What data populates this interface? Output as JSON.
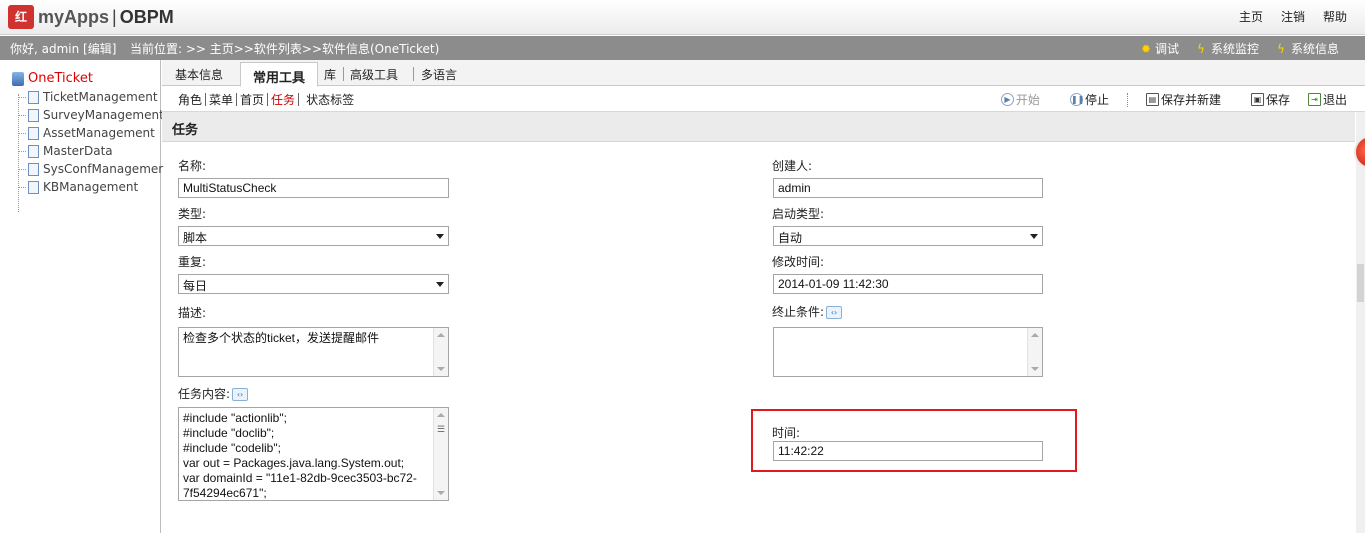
{
  "header": {
    "logo_mark": "红",
    "app_name": "myApps",
    "separator": "|",
    "product": "OBPM",
    "links": [
      "主页",
      "注销",
      "帮助"
    ]
  },
  "infobar": {
    "greeting": "你好, admin [编辑]",
    "breadcrumb": "当前位置: >> 主页>>软件列表>>软件信息(OneTicket)",
    "tools": [
      {
        "label": "调试",
        "icon": "debug-icon"
      },
      {
        "label": "系统监控",
        "icon": "lightning-icon"
      },
      {
        "label": "系统信息",
        "icon": "lightning-icon"
      }
    ]
  },
  "tree": {
    "root": "OneTicket",
    "items": [
      "TicketManagement",
      "SurveyManagement",
      "AssetManagement",
      "MasterData",
      "SysConfManagemer",
      "KBManagement"
    ]
  },
  "tabs": {
    "items": [
      "基本信息",
      "常用工具",
      "库",
      "高级工具",
      "多语言"
    ],
    "active": "常用工具"
  },
  "subtabs": {
    "items": [
      "角色",
      "菜单",
      "首页",
      "任务",
      "状态标签"
    ],
    "active": "任务"
  },
  "actions": {
    "start": "开始",
    "stop": "停止",
    "save_new": "保存并新建",
    "save": "保存",
    "exit": "退出"
  },
  "section_title": "任务",
  "form": {
    "name_label": "名称:",
    "name_value": "MultiStatusCheck",
    "creator_label": "创建人:",
    "creator_value": "admin",
    "type_label": "类型:",
    "type_value": "脚本",
    "start_type_label": "启动类型:",
    "start_type_value": "自动",
    "repeat_label": "重复:",
    "repeat_value": "每日",
    "modified_label": "修改时间:",
    "modified_value": "2014-01-09 11:42:30",
    "desc_label": "描述:",
    "desc_value": "检查多个状态的ticket，发送提醒邮件",
    "end_cond_label": "终止条件:",
    "end_cond_value": "",
    "content_label": "任务内容:",
    "content_lines": [
      "#include \"actionlib\";",
      "#include \"doclib\";",
      "#include \"codelib\";",
      "var out = Packages.java.lang.System.out;",
      "var domainId = \"11e1-82db-9cec3503-bc72-",
      "7f54294ec671\";"
    ],
    "time_label": "时间:",
    "time_value": "11:42:22"
  }
}
